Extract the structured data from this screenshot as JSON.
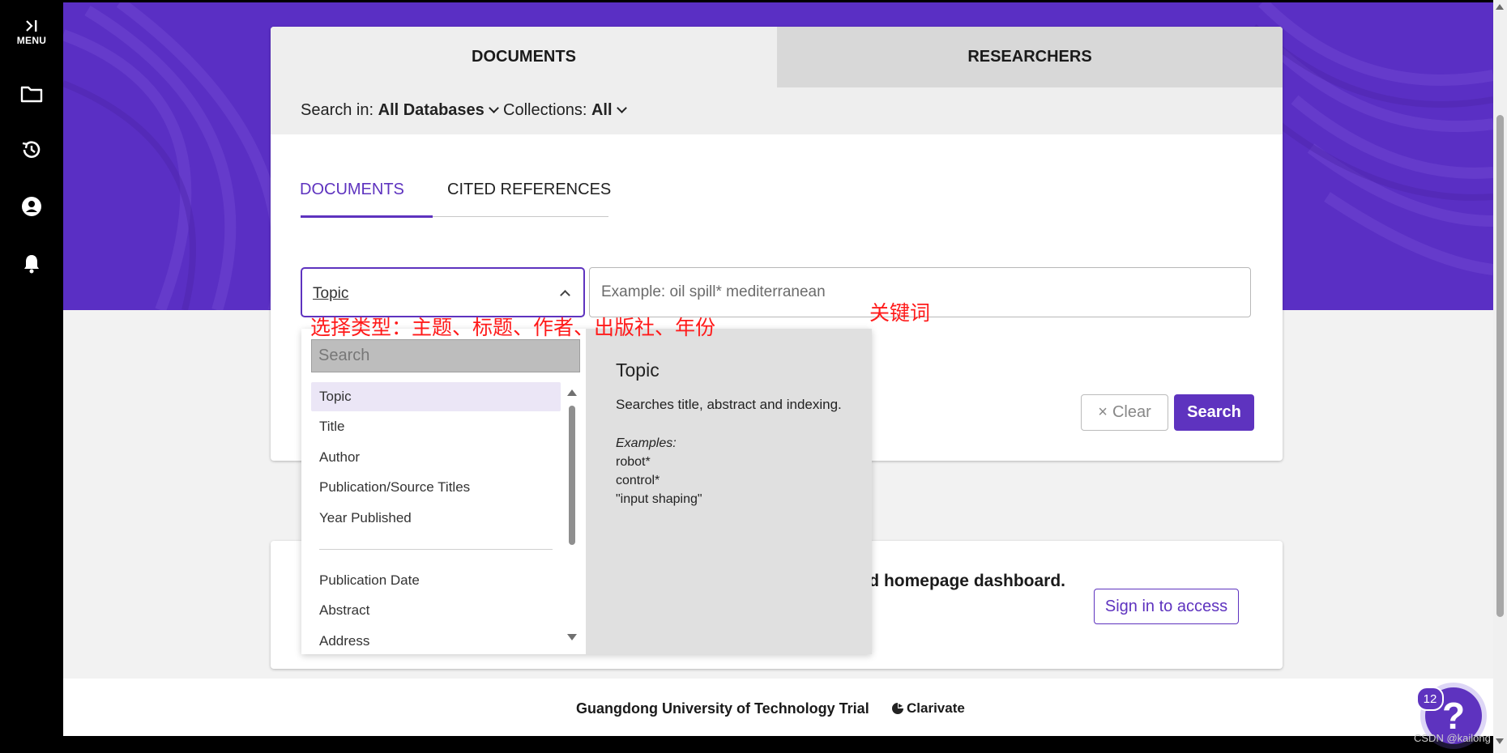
{
  "sidebar": {
    "menu_label": "MENU",
    "items": [
      {
        "icon": "folder-icon"
      },
      {
        "icon": "history-icon"
      },
      {
        "icon": "account-icon"
      },
      {
        "icon": "bell-icon"
      }
    ]
  },
  "search_card": {
    "tabs": [
      "DOCUMENTS",
      "RESEARCHERS"
    ],
    "search_in_label": "Search in:",
    "search_in_value": "All Databases",
    "collections_label": "Collections:",
    "collections_value": "All",
    "sub_tabs": [
      "DOCUMENTS",
      "CITED REFERENCES"
    ],
    "field_selected": "Topic",
    "query_placeholder": "Example: oil spill* mediterranean",
    "query_value": "",
    "clear_label": "Clear",
    "search_label": "Search"
  },
  "dropdown": {
    "search_placeholder": "Search",
    "options_primary": [
      "Topic",
      "Title",
      "Author",
      "Publication/Source Titles",
      "Year Published"
    ],
    "options_secondary": [
      "Publication Date",
      "Abstract",
      "Address"
    ],
    "selected_option": "Topic",
    "info_title": "Topic",
    "info_description": "Searches title, abstract and indexing.",
    "info_examples_label": "Examples:",
    "info_examples": [
      "robot*",
      "control*",
      "\"input shaping\""
    ]
  },
  "annotations": {
    "field_type": "选择类型：主题、标题、作者、出版社、年份",
    "keyword": "关键词"
  },
  "promo": {
    "text": "d homepage dashboard.",
    "signin_label": "Sign in to access"
  },
  "footer": {
    "institution": "Guangdong University of Technology Trial",
    "brand": "Clarivate"
  },
  "help": {
    "badge_count": "12"
  },
  "watermark": "CSDN @kailong"
}
